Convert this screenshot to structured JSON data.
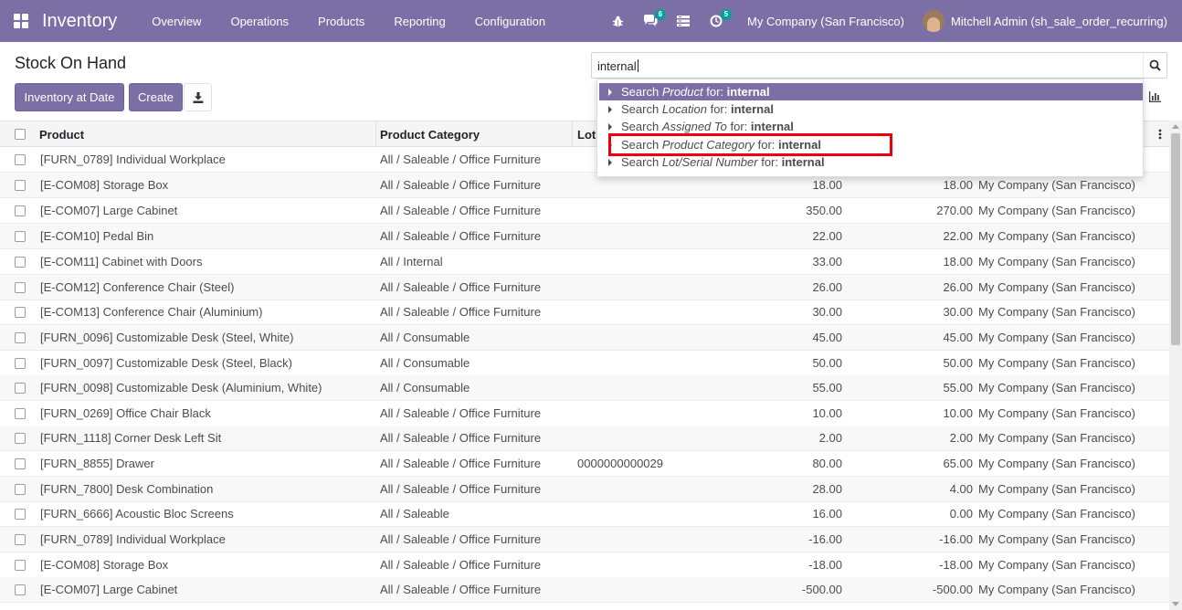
{
  "navbar": {
    "app_title": "Inventory",
    "menu": [
      "Overview",
      "Operations",
      "Products",
      "Reporting",
      "Configuration"
    ],
    "chat_badge": "6",
    "activity_badge": "5",
    "company": "My Company (San Francisco)",
    "user": "Mitchell Admin (sh_sale_order_recurring)"
  },
  "page": {
    "title": "Stock On Hand",
    "btn_inventory_at_date": "Inventory at Date",
    "btn_create": "Create"
  },
  "search": {
    "value": "internal",
    "suggestions": [
      {
        "prefix": "Search ",
        "field": "Product",
        "middle": " for: ",
        "term": "internal"
      },
      {
        "prefix": "Search ",
        "field": "Location",
        "middle": " for: ",
        "term": "internal"
      },
      {
        "prefix": "Search ",
        "field": "Assigned To",
        "middle": " for: ",
        "term": "internal"
      },
      {
        "prefix": "Search ",
        "field": "Product Category",
        "middle": " for: ",
        "term": "internal"
      },
      {
        "prefix": "Search ",
        "field": "Lot/Serial Number",
        "middle": " for: ",
        "term": "internal"
      }
    ]
  },
  "table": {
    "headers": {
      "product": "Product",
      "category": "Product Category",
      "lot": "Lot"
    },
    "rows": [
      {
        "product": "[FURN_0789] Individual Workplace",
        "category": "All / Saleable / Office Furniture",
        "lot": "",
        "qty1": "",
        "qty2": "",
        "company": ""
      },
      {
        "product": "[E-COM08] Storage Box",
        "category": "All / Saleable / Office Furniture",
        "lot": "",
        "qty1": "18.00",
        "qty2": "18.00",
        "company": "My Company (San Francisco)"
      },
      {
        "product": "[E-COM07] Large Cabinet",
        "category": "All / Saleable / Office Furniture",
        "lot": "",
        "qty1": "350.00",
        "qty2": "270.00",
        "company": "My Company (San Francisco)"
      },
      {
        "product": "[E-COM10] Pedal Bin",
        "category": "All / Saleable / Office Furniture",
        "lot": "",
        "qty1": "22.00",
        "qty2": "22.00",
        "company": "My Company (San Francisco)"
      },
      {
        "product": "[E-COM11] Cabinet with Doors",
        "category": "All / Internal",
        "lot": "",
        "qty1": "33.00",
        "qty2": "18.00",
        "company": "My Company (San Francisco)"
      },
      {
        "product": "[E-COM12] Conference Chair (Steel)",
        "category": "All / Saleable / Office Furniture",
        "lot": "",
        "qty1": "26.00",
        "qty2": "26.00",
        "company": "My Company (San Francisco)"
      },
      {
        "product": "[E-COM13] Conference Chair (Aluminium)",
        "category": "All / Saleable / Office Furniture",
        "lot": "",
        "qty1": "30.00",
        "qty2": "30.00",
        "company": "My Company (San Francisco)"
      },
      {
        "product": "[FURN_0096] Customizable Desk (Steel, White)",
        "category": "All / Consumable",
        "lot": "",
        "qty1": "45.00",
        "qty2": "45.00",
        "company": "My Company (San Francisco)"
      },
      {
        "product": "[FURN_0097] Customizable Desk (Steel, Black)",
        "category": "All / Consumable",
        "lot": "",
        "qty1": "50.00",
        "qty2": "50.00",
        "company": "My Company (San Francisco)"
      },
      {
        "product": "[FURN_0098] Customizable Desk (Aluminium, White)",
        "category": "All / Consumable",
        "lot": "",
        "qty1": "55.00",
        "qty2": "55.00",
        "company": "My Company (San Francisco)"
      },
      {
        "product": "[FURN_0269] Office Chair Black",
        "category": "All / Saleable / Office Furniture",
        "lot": "",
        "qty1": "10.00",
        "qty2": "10.00",
        "company": "My Company (San Francisco)"
      },
      {
        "product": "[FURN_1118] Corner Desk Left Sit",
        "category": "All / Saleable / Office Furniture",
        "lot": "",
        "qty1": "2.00",
        "qty2": "2.00",
        "company": "My Company (San Francisco)"
      },
      {
        "product": "[FURN_8855] Drawer",
        "category": "All / Saleable / Office Furniture",
        "lot": "0000000000029",
        "qty1": "80.00",
        "qty2": "65.00",
        "company": "My Company (San Francisco)"
      },
      {
        "product": "[FURN_7800] Desk Combination",
        "category": "All / Saleable / Office Furniture",
        "lot": "",
        "qty1": "28.00",
        "qty2": "4.00",
        "company": "My Company (San Francisco)"
      },
      {
        "product": "[FURN_6666] Acoustic Bloc Screens",
        "category": "All / Saleable",
        "lot": "",
        "qty1": "16.00",
        "qty2": "0.00",
        "company": "My Company (San Francisco)"
      },
      {
        "product": "[FURN_0789] Individual Workplace",
        "category": "All / Saleable / Office Furniture",
        "lot": "",
        "qty1": "-16.00",
        "qty2": "-16.00",
        "company": "My Company (San Francisco)"
      },
      {
        "product": "[E-COM08] Storage Box",
        "category": "All / Saleable / Office Furniture",
        "lot": "",
        "qty1": "-18.00",
        "qty2": "-18.00",
        "company": "My Company (San Francisco)"
      },
      {
        "product": "[E-COM07] Large Cabinet",
        "category": "All / Saleable / Office Furniture",
        "lot": "",
        "qty1": "-500.00",
        "qty2": "-500.00",
        "company": "My Company (San Francisco)"
      }
    ]
  },
  "colors": {
    "brand": "#7c6fa5",
    "badge": "#00a09d",
    "highlight_box": "#e8000b"
  }
}
